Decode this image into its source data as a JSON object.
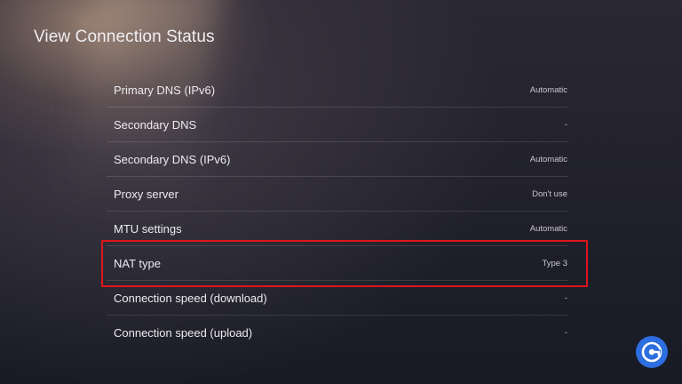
{
  "header": {
    "title": "View Connection Status"
  },
  "settings": {
    "rows": [
      {
        "label": "Primary DNS (IPv6)",
        "value": "Automatic"
      },
      {
        "label": "Secondary DNS",
        "value": "-"
      },
      {
        "label": "Secondary DNS (IPv6)",
        "value": "Automatic"
      },
      {
        "label": "Proxy server",
        "value": "Don't use"
      },
      {
        "label": "MTU settings",
        "value": "Automatic"
      },
      {
        "label": "NAT type",
        "value": "Type 3"
      },
      {
        "label": "Connection speed (download)",
        "value": "-"
      },
      {
        "label": "Connection speed (upload)",
        "value": "-"
      }
    ]
  },
  "colors": {
    "highlight": "#e0151c",
    "logo": "#2d6ee0"
  },
  "icons": {
    "logo": "gamer-tweak-logo-icon"
  }
}
